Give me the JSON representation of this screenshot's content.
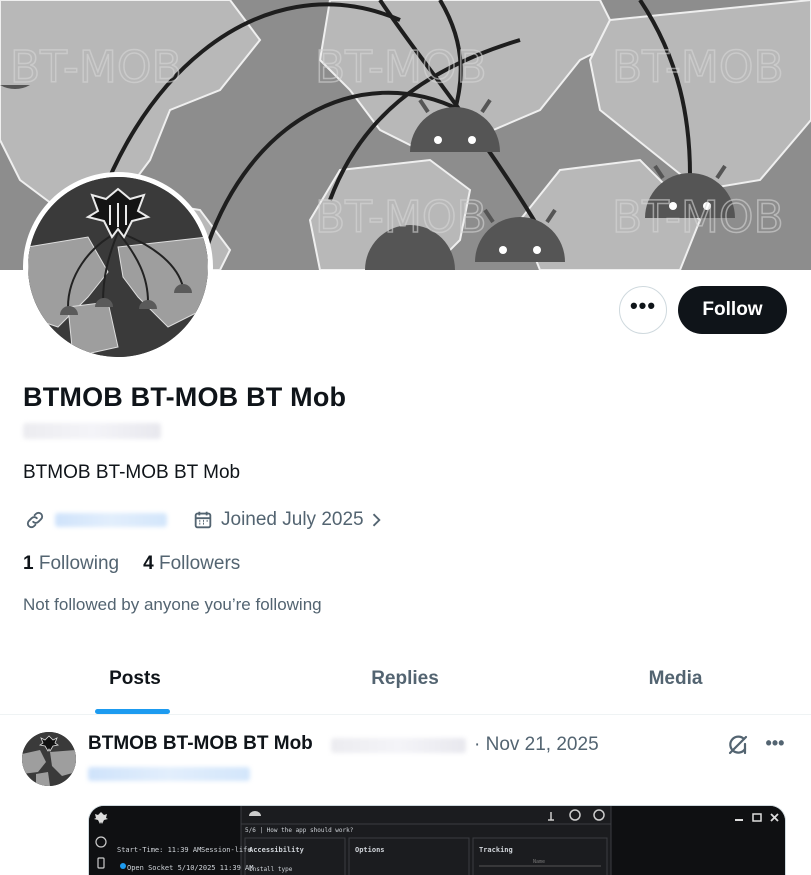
{
  "banner": {
    "watermark": "BT-MOB"
  },
  "actions": {
    "more_label": "•••",
    "follow_label": "Follow"
  },
  "profile": {
    "display_name": "BTMOB BT-MOB BT Mob",
    "bio": "BTMOB BT-MOB BT Mob",
    "joined": "Joined July 2025",
    "following_count": "1",
    "following_label": "Following",
    "followers_count": "4",
    "followers_label": "Followers",
    "not_followed": "Not followed by anyone you’re following"
  },
  "tabs": [
    {
      "label": "Posts",
      "active": true
    },
    {
      "label": "Replies",
      "active": false
    },
    {
      "label": "Media",
      "active": false
    }
  ],
  "post": {
    "author_name": "BTMOB BT-MOB BT Mob",
    "date": "· Nov 21, 2025",
    "media": {
      "start_time": "Start-Time: 11:39 AM",
      "session": "Session-life",
      "open_socket": "Open Socket 5/10/2025 11:39 AM",
      "question": "5/6 | How the app should work?",
      "accessibility": "Accessibility",
      "install_type": "Install type",
      "options": "Options",
      "tracking": "Tracking",
      "name_placeholder": "Name"
    }
  },
  "colors": {
    "accent": "#1d9bf0",
    "text": "#0f1419",
    "muted": "#536471",
    "border": "#cfd9de"
  }
}
